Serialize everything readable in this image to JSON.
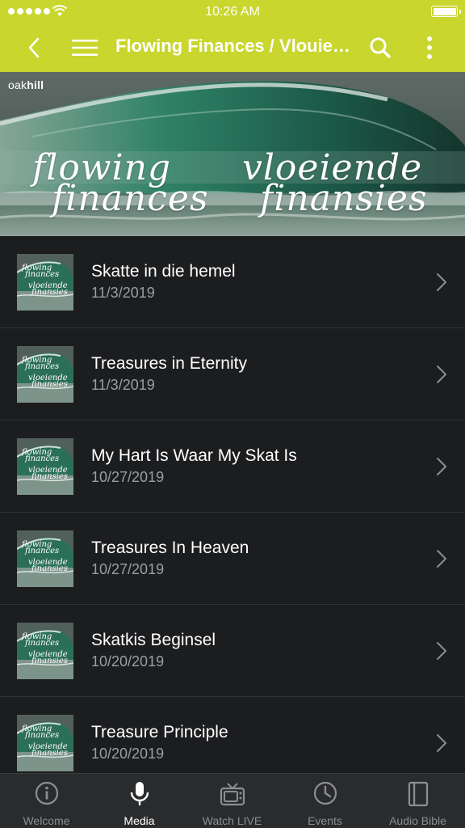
{
  "status_bar": {
    "time": "10:26 AM"
  },
  "header": {
    "title": "Flowing Finances / Vlouiende Finansies"
  },
  "banner": {
    "brand_light": "oak",
    "brand_bold": "hill",
    "script_left_1": "flowing",
    "script_left_2": "finances",
    "script_right_1": "vloeiende",
    "script_right_2": "finansies"
  },
  "thumb_text": {
    "line1": "flowing",
    "line2": "finances",
    "line3": "vloeiende",
    "line4": "finansies"
  },
  "items": [
    {
      "title": "Skatte in die hemel",
      "date": "11/3/2019"
    },
    {
      "title": "Treasures in Eternity",
      "date": "11/3/2019"
    },
    {
      "title": "My Hart Is Waar My Skat Is",
      "date": "10/27/2019"
    },
    {
      "title": "Treasures In Heaven",
      "date": "10/27/2019"
    },
    {
      "title": "Skatkis Beginsel",
      "date": "10/20/2019"
    },
    {
      "title": "Treasure Principle",
      "date": "10/20/2019"
    }
  ],
  "tabs": [
    {
      "label": "Welcome",
      "icon": "info-icon"
    },
    {
      "label": "Media",
      "icon": "microphone-icon",
      "active": true
    },
    {
      "label": "Watch LIVE",
      "icon": "tv-icon"
    },
    {
      "label": "Events",
      "icon": "clock-icon"
    },
    {
      "label": "Audio Bible",
      "icon": "book-icon"
    }
  ],
  "colors": {
    "accent": "#c8d62d",
    "background": "#1c1d1f",
    "tabbar": "#2a2b2d"
  }
}
